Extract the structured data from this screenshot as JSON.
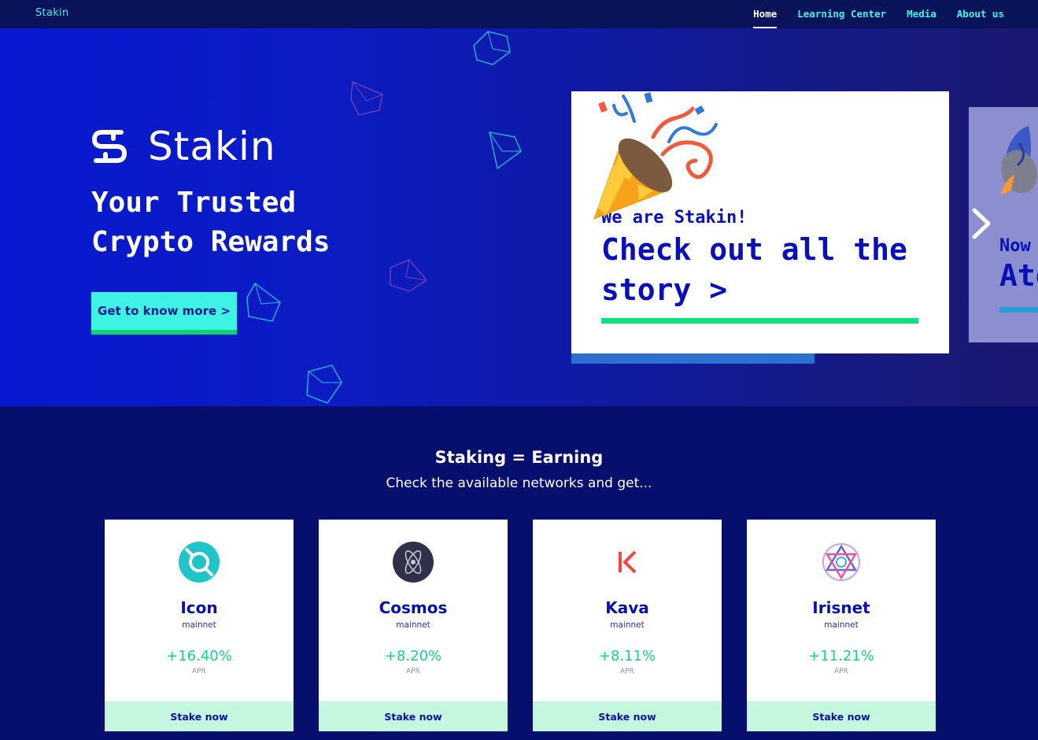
{
  "nav": {
    "logo": "Stakin",
    "links": [
      {
        "label": "Home",
        "active": true
      },
      {
        "label": "Learning Center",
        "active": false
      },
      {
        "label": "Media",
        "active": false
      },
      {
        "label": "About us",
        "active": false
      }
    ]
  },
  "hero": {
    "brand": "Stakin",
    "tagline": "Your Trusted Crypto Rewards",
    "cta": "Get to know more >",
    "slide": {
      "kicker": "We are Stakin!",
      "title": "Check out all the story >",
      "icon": "party-popper-icon"
    },
    "next_slide": {
      "kicker": "Now",
      "title": "Ato",
      "icon": "rocket-icon"
    }
  },
  "networks": {
    "title": "Staking = Earning",
    "subtitle": "Check the available networks and get...",
    "cards": [
      {
        "name": "Icon",
        "network": "mainnet",
        "apr": "+16.40%",
        "apr_label": "APR",
        "button": "Stake now",
        "icon": "icon-logo",
        "color": "#1fc5c9"
      },
      {
        "name": "Cosmos",
        "network": "mainnet",
        "apr": "+8.20%",
        "apr_label": "APR",
        "button": "Stake now",
        "icon": "cosmos-logo",
        "color": "#2e3148"
      },
      {
        "name": "Kava",
        "network": "mainnet",
        "apr": "+8.11%",
        "apr_label": "APR",
        "button": "Stake now",
        "icon": "kava-logo",
        "color": "#ff433e"
      },
      {
        "name": "Irisnet",
        "network": "mainnet",
        "apr": "+11.21%",
        "apr_label": "APR",
        "button": "Stake now",
        "icon": "irisnet-logo",
        "color": "#6a62d9"
      }
    ]
  },
  "colors": {
    "accent": "#3ef2e4",
    "green": "#0ed26e",
    "navy": "#060e6e",
    "primary_text": "#0a10b8"
  }
}
